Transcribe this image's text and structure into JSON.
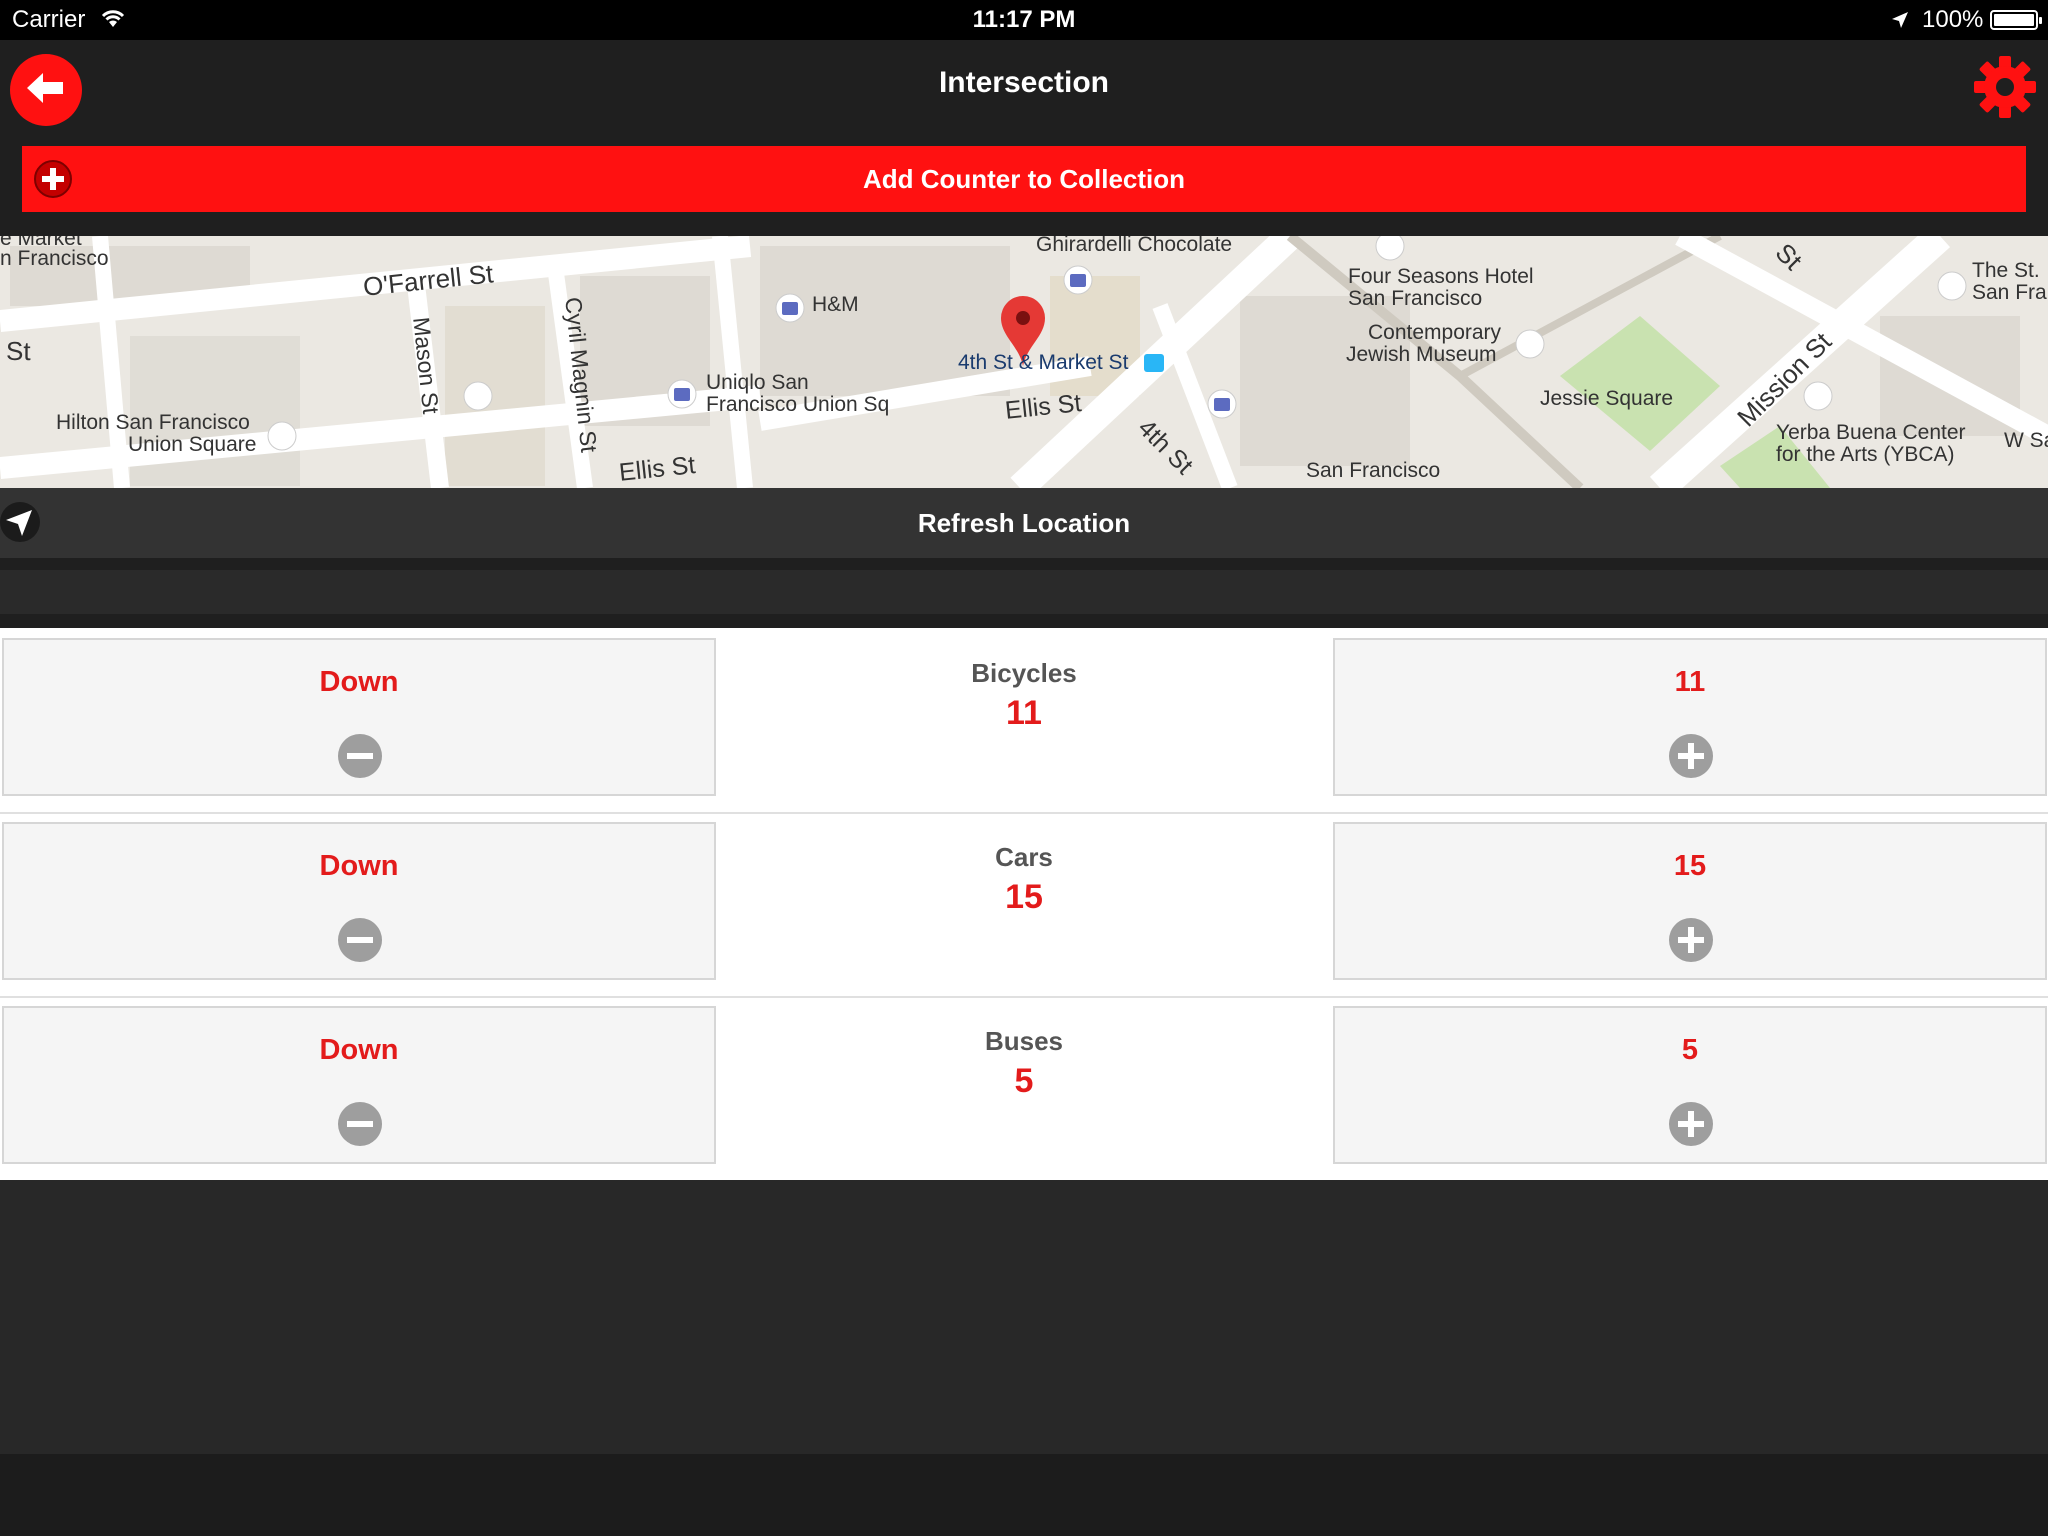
{
  "status_bar": {
    "carrier": "Carrier",
    "time": "11:17 PM",
    "battery": "100%"
  },
  "nav": {
    "title": "Intersection",
    "add_counter_label": "Add Counter to Collection"
  },
  "map": {
    "labels": {
      "market": "e Market",
      "francisco": "n Francisco",
      "st_left": "St",
      "ofarrell": "O'Farrell St",
      "mason": "Mason St",
      "cyril": "Cyril Magnin St",
      "hm": "H&M",
      "ghirardelli": "Ghirardelli Chocolate",
      "hilton1": "Hilton San Francisco",
      "hilton2": "Union Square",
      "uniqlo1": "Uniqlo San",
      "uniqlo2": "Francisco Union Sq",
      "ellis1": "Ellis St",
      "ellis2": "Ellis St",
      "fourth_market": "4th St & Market St",
      "fourth": "4th St",
      "four_seasons1": "Four Seasons Hotel",
      "four_seasons2": "San Francisco",
      "cjm1": "Contemporary",
      "cjm2": "Jewish Museum",
      "jessie": "Jessie Square",
      "mission": "Mission St",
      "st_top": "St",
      "the_st1": "The St.",
      "the_st2": "San Fra",
      "ybca1": "Yerba Buena Center",
      "ybca2": "for the Arts (YBCA)",
      "sf": "San Francisco",
      "wsa": "W Sa"
    },
    "pin_color": "#e53935"
  },
  "refresh_label": "Refresh Location",
  "counters": [
    {
      "name": "Bicycles",
      "count": "11",
      "down_label": "Down",
      "up_label": "11"
    },
    {
      "name": "Cars",
      "count": "15",
      "down_label": "Down",
      "up_label": "15"
    },
    {
      "name": "Buses",
      "count": "5",
      "down_label": "Down",
      "up_label": "5"
    }
  ],
  "colors": {
    "accent": "#ff1111",
    "count_red": "#e31b1b",
    "dark_bg": "#1f1f1f"
  }
}
